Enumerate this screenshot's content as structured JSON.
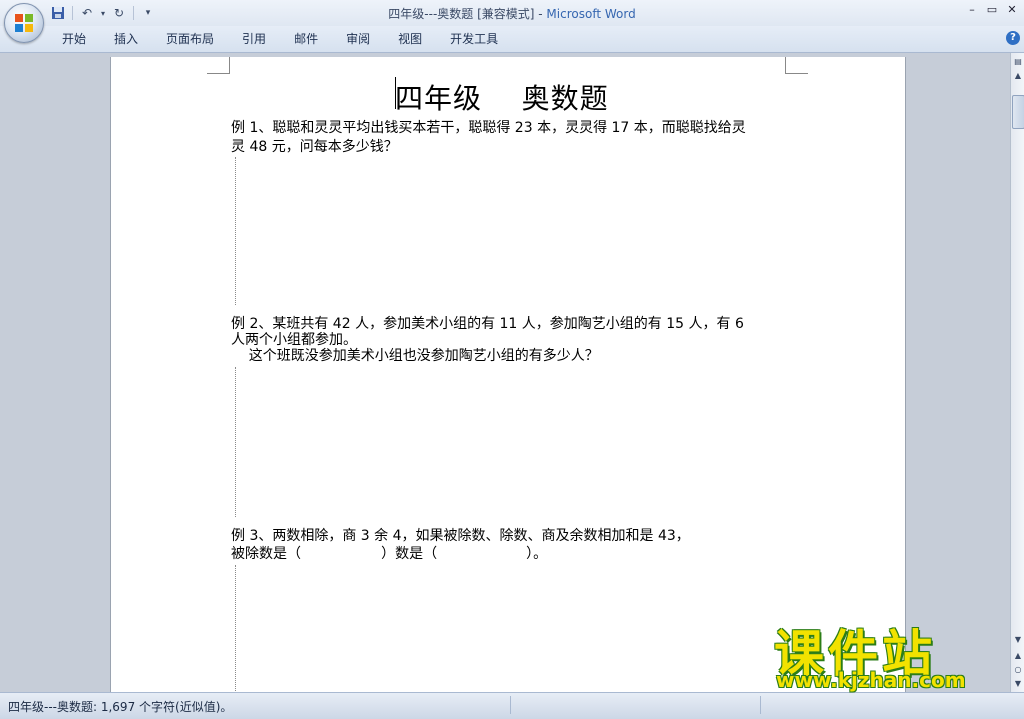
{
  "window": {
    "doc_name": "四年级---奥数题 [兼容模式]",
    "separator": " - ",
    "app_name": "Microsoft Word"
  },
  "ribbon": {
    "tabs": [
      "开始",
      "插入",
      "页面布局",
      "引用",
      "邮件",
      "审阅",
      "视图",
      "开发工具"
    ],
    "help": "?"
  },
  "document": {
    "title": "四年级    奥数题",
    "q1_line1": "例 1、聪聪和灵灵平均出钱买本若干，聪聪得 23 本，灵灵得 17 本，而聪聪找给灵",
    "q1_line2": "灵 48 元，问每本多少钱？",
    "q2_line1": "例 2、某班共有 42 人，参加美术小组的有 11 人，参加陶艺小组的有 15 人，有 6",
    "q2_line2": "人两个小组都参加。",
    "q2_line3": "    这个班既没参加美术小组也没参加陶艺小组的有多少人？",
    "q3_line1": "例 3、两数相除，商 3 余 4，如果被除数、除数、商及余数相加和是 43，",
    "q3_line2": "被除数是（                  ）数是（                    ）。"
  },
  "status": {
    "text": "四年级---奥数题: 1,697 个字符(近似值)。"
  },
  "watermark": {
    "main": "课件站",
    "url": "www.kjzhan.com"
  },
  "colors": {
    "accent_app": "#3566b0",
    "watermark_fill": "#f2e200",
    "watermark_outline": "#2c7d17"
  }
}
